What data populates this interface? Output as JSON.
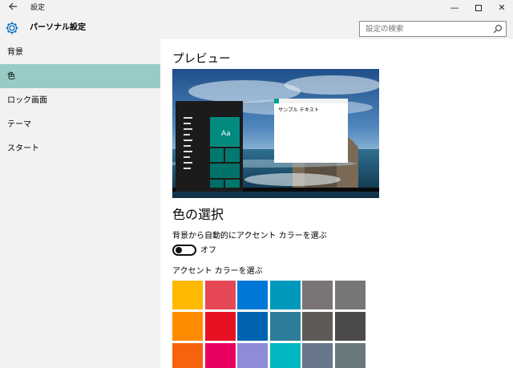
{
  "window": {
    "title": "設定",
    "back_icon": "back-arrow-icon",
    "min_glyph": "—",
    "close_glyph": "✕"
  },
  "header": {
    "title": "パーソナル設定",
    "search_placeholder": "設定の検索"
  },
  "sidebar": {
    "items": [
      {
        "label": "背景",
        "selected": false
      },
      {
        "label": "色",
        "selected": true
      },
      {
        "label": "ロック画面",
        "selected": false
      },
      {
        "label": "テーマ",
        "selected": false
      },
      {
        "label": "スタート",
        "selected": false
      }
    ]
  },
  "main": {
    "preview_heading": "プレビュー",
    "preview": {
      "tile_text": "Aa",
      "sample_window_text": "サンプル テキスト"
    },
    "color_heading": "色の選択",
    "auto_pick_label": "背景から自動的にアクセント カラーを選ぶ",
    "auto_pick_state": "オフ",
    "auto_pick_on": false,
    "accent_label": "アクセント カラーを選ぶ"
  },
  "accent_colors": [
    [
      "#ffb900",
      "#e74856",
      "#0078d7",
      "#0099bc",
      "#7a7574",
      "#767676"
    ],
    [
      "#ff8c00",
      "#e81123",
      "#0063b1",
      "#2d7d9a",
      "#5d5a58",
      "#4c4a48"
    ],
    [
      "#f7630c",
      "#ea005e",
      "#8e8cd8",
      "#00b7c3",
      "#68768a",
      "#69797e"
    ]
  ],
  "colors": {
    "accent": "#0a73c9",
    "selected_nav": "#99cbc6",
    "preview_teal": "#008a80"
  }
}
